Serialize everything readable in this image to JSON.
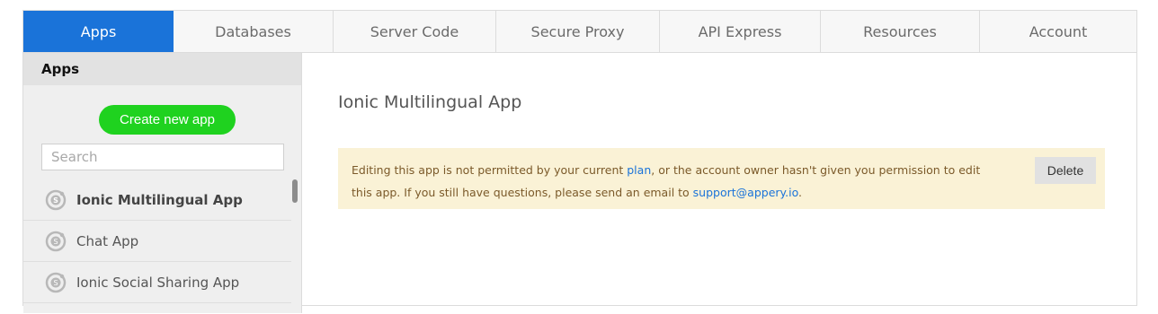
{
  "tabs": [
    {
      "label": "Apps"
    },
    {
      "label": "Databases"
    },
    {
      "label": "Server Code"
    },
    {
      "label": "Secure Proxy"
    },
    {
      "label": "API Express"
    },
    {
      "label": "Resources"
    },
    {
      "label": "Account"
    }
  ],
  "sidebar": {
    "heading": "Apps",
    "create_label": "Create new app",
    "search_placeholder": "Search",
    "items": [
      {
        "label": "Ionic Multilingual App",
        "icon": "ionic-app-icon"
      },
      {
        "label": "Chat App",
        "icon": "ionic-app-icon"
      },
      {
        "label": "Ionic Social Sharing App",
        "icon": "ionic-app-icon"
      }
    ]
  },
  "main": {
    "title": "Ionic Multilingual App",
    "notice": {
      "text_before_plan": "Editing this app is not permitted by your current ",
      "plan_link": "plan",
      "text_after_plan": ", or the account owner hasn't given you permission to edit this app. If you still have questions, please send an email to ",
      "email_link": "support@appery.io",
      "text_end": "."
    },
    "delete_label": "Delete"
  },
  "colors": {
    "accent": "#1a73d9",
    "create_button": "#1fd21f",
    "notice_background": "#faf2d6"
  }
}
